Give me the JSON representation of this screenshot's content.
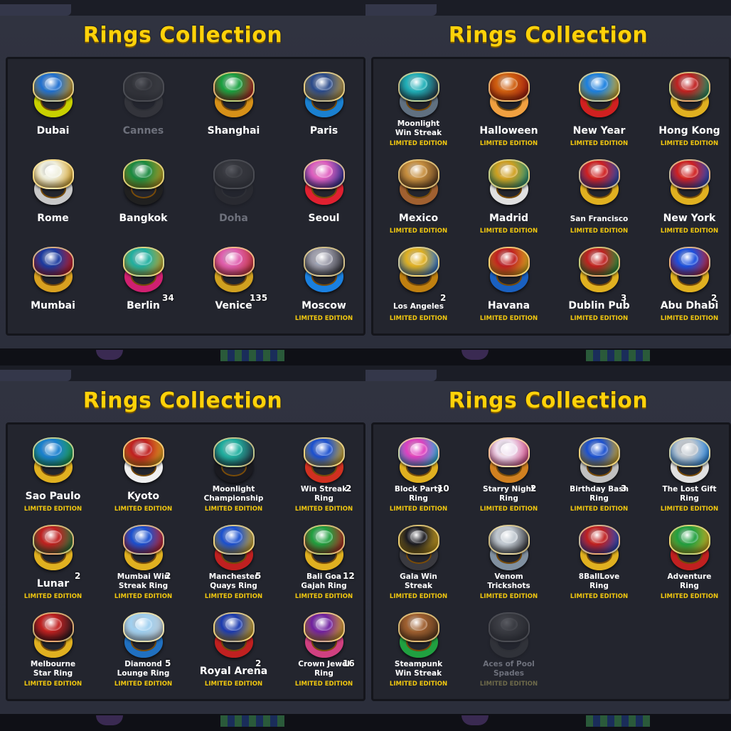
{
  "title": "Rings Collection",
  "limited_label": "LIMITED EDITION",
  "quadrants": [
    {
      "rings": [
        {
          "name": "Dubai",
          "collected": true,
          "colors": [
            "#1e6fd0",
            "#d89a1a",
            "#c8d000"
          ]
        },
        {
          "name": "Cannes",
          "collected": false,
          "colors": [
            "#c0402a",
            "#8a8a8a",
            "#b05050"
          ]
        },
        {
          "name": "Shanghai",
          "collected": true,
          "colors": [
            "#18a040",
            "#c01820",
            "#d69018"
          ]
        },
        {
          "name": "Paris",
          "collected": true,
          "colors": [
            "#2a4a8a",
            "#c8a040",
            "#1a80d0"
          ]
        },
        {
          "name": "Rome",
          "collected": true,
          "colors": [
            "#f0f0e0",
            "#d6a020",
            "#c8c8c8"
          ]
        },
        {
          "name": "Bangkok",
          "collected": true,
          "colors": [
            "#1a8a40",
            "#c89a20",
            "#202020"
          ]
        },
        {
          "name": "Doha",
          "collected": false,
          "colors": [
            "#7a6a4a",
            "#505a7a",
            "#3a3a4a"
          ]
        },
        {
          "name": "Seoul",
          "collected": true,
          "colors": [
            "#e060c0",
            "#1a2a8a",
            "#e02030"
          ]
        },
        {
          "name": "Mumbai",
          "collected": true,
          "colors": [
            "#1a3aa0",
            "#d01818",
            "#d8a020"
          ]
        },
        {
          "name": "Berlin",
          "collected": true,
          "count": "34",
          "colors": [
            "#20b0a0",
            "#d0a020",
            "#d02070"
          ]
        },
        {
          "name": "Venice",
          "collected": true,
          "count": "135",
          "colors": [
            "#e060b0",
            "#c03030",
            "#d0a020"
          ]
        },
        {
          "name": "Moscow",
          "collected": true,
          "limited": true,
          "colors": [
            "#9a9aa8",
            "#2a2a30",
            "#1a80e0"
          ]
        }
      ]
    },
    {
      "rings": [
        {
          "name": "Moonlight\nWin Streak",
          "small": true,
          "collected": true,
          "limited": true,
          "colors": [
            "#20b0b8",
            "#2a3040",
            "#607080"
          ]
        },
        {
          "name": "Halloween",
          "collected": true,
          "limited": true,
          "colors": [
            "#d06010",
            "#a01810",
            "#f0a040"
          ]
        },
        {
          "name": "New Year",
          "collected": true,
          "limited": true,
          "colors": [
            "#1a80e0",
            "#e0b020",
            "#d02020"
          ]
        },
        {
          "name": "Hong Kong",
          "collected": true,
          "limited": true,
          "colors": [
            "#c02020",
            "#18a070",
            "#e0b020"
          ]
        },
        {
          "name": "Mexico",
          "collected": true,
          "limited": true,
          "colors": [
            "#c89040",
            "#5a3a20",
            "#a06030"
          ]
        },
        {
          "name": "Madrid",
          "collected": true,
          "limited": true,
          "colors": [
            "#d0a020",
            "#1a9080",
            "#e0e0e0"
          ]
        },
        {
          "name": "San Francisco",
          "small": true,
          "collected": true,
          "limited": true,
          "colors": [
            "#d02020",
            "#1a50c0",
            "#e0b020"
          ]
        },
        {
          "name": "New York",
          "collected": true,
          "limited": true,
          "colors": [
            "#d02020",
            "#1a50d0",
            "#e0b020"
          ]
        },
        {
          "name": "Los Angeles",
          "small": true,
          "collected": true,
          "limited": true,
          "count": "2",
          "colors": [
            "#e0b020",
            "#2070e0",
            "#c08010"
          ]
        },
        {
          "name": "Havana",
          "collected": true,
          "limited": true,
          "colors": [
            "#c02020",
            "#e0c020",
            "#1a60c0"
          ]
        },
        {
          "name": "Dublin Pub",
          "collected": true,
          "limited": true,
          "count": "3",
          "colors": [
            "#c02020",
            "#20a040",
            "#e0b020"
          ]
        },
        {
          "name": "Abu Dhabi",
          "collected": true,
          "limited": true,
          "count": "2",
          "colors": [
            "#1a50e0",
            "#d02020",
            "#e0b020"
          ]
        }
      ]
    },
    {
      "rings": [
        {
          "name": "Sao Paulo",
          "collected": true,
          "limited": true,
          "colors": [
            "#1a80d0",
            "#20a040",
            "#e0b020"
          ]
        },
        {
          "name": "Kyoto",
          "collected": true,
          "limited": true,
          "colors": [
            "#c02020",
            "#e0b020",
            "#f0f0f0"
          ]
        },
        {
          "name": "Moonlight\nChampionship",
          "small": true,
          "collected": true,
          "limited": true,
          "colors": [
            "#20b0a0",
            "#2a3040",
            "#1a1a20"
          ]
        },
        {
          "name": "Win Streak\nRing",
          "small": true,
          "collected": true,
          "limited": true,
          "count": "2",
          "colors": [
            "#1a50d0",
            "#e0b020",
            "#d03020"
          ]
        },
        {
          "name": "Lunar",
          "collected": true,
          "limited": true,
          "count": "2",
          "colors": [
            "#c02020",
            "#208040",
            "#e0b020"
          ]
        },
        {
          "name": "Mumbai Win\nStreak Ring",
          "small": true,
          "collected": true,
          "limited": true,
          "count": "2",
          "colors": [
            "#1a50d0",
            "#d02020",
            "#e0b020"
          ]
        },
        {
          "name": "Manchester\nQuays Ring",
          "small": true,
          "collected": true,
          "limited": true,
          "count": "5",
          "colors": [
            "#1a50d0",
            "#e0b020",
            "#c02020"
          ]
        },
        {
          "name": "Bali Goa\nGajah Ring",
          "small": true,
          "collected": true,
          "limited": true,
          "count": "12",
          "colors": [
            "#20a040",
            "#c02020",
            "#e0b020"
          ]
        },
        {
          "name": "Melbourne\nStar Ring",
          "small": true,
          "collected": true,
          "limited": true,
          "colors": [
            "#c02020",
            "#1a1a20",
            "#e0b020"
          ]
        },
        {
          "name": "Diamond\nLounge Ring",
          "small": true,
          "collected": true,
          "limited": true,
          "count": "5",
          "colors": [
            "#a0d0f0",
            "#c0c8d0",
            "#2070c0"
          ]
        },
        {
          "name": "Royal Arena",
          "collected": true,
          "limited": true,
          "count": "2",
          "colors": [
            "#1a3ab0",
            "#e0b020",
            "#c02020"
          ]
        },
        {
          "name": "Crown Jewel\nRing",
          "small": true,
          "collected": true,
          "limited": true,
          "count": "16",
          "colors": [
            "#7020a0",
            "#e0b020",
            "#d04080"
          ]
        }
      ]
    },
    {
      "rings": [
        {
          "name": "Block Party\nRing",
          "small": true,
          "collected": true,
          "limited": true,
          "count": "10",
          "colors": [
            "#e040c0",
            "#20c0e0",
            "#e0b020"
          ]
        },
        {
          "name": "Starry Night\nRing",
          "small": true,
          "collected": true,
          "limited": true,
          "count": "2",
          "colors": [
            "#f0e0f0",
            "#d04080",
            "#d08020"
          ]
        },
        {
          "name": "Birthday Bash\nRing",
          "small": true,
          "collected": true,
          "limited": true,
          "count": "3",
          "colors": [
            "#1a50d0",
            "#e0b020",
            "#c0c0c0"
          ]
        },
        {
          "name": "The Lost Gift\nRing",
          "small": true,
          "collected": true,
          "limited": true,
          "colors": [
            "#c0c8d0",
            "#1a80e0",
            "#e0e0e0"
          ]
        },
        {
          "name": "Gala Win\nStreak",
          "small": true,
          "collected": true,
          "limited": true,
          "colors": [
            "#1a1a20",
            "#e0b020",
            "#3a3a40"
          ]
        },
        {
          "name": "Venom\nTrickshots",
          "small": true,
          "collected": true,
          "limited": true,
          "colors": [
            "#c0c8d0",
            "#2a2a30",
            "#8090a0"
          ]
        },
        {
          "name": "8BallLove\nRing",
          "small": true,
          "collected": true,
          "limited": true,
          "colors": [
            "#c02020",
            "#1a50d0",
            "#e0b020"
          ]
        },
        {
          "name": "Adventure\nRing",
          "small": true,
          "collected": true,
          "limited": true,
          "colors": [
            "#20a040",
            "#e0b020",
            "#c02020"
          ]
        },
        {
          "name": "Steampunk\nWin Streak",
          "small": true,
          "collected": true,
          "limited": true,
          "colors": [
            "#a06030",
            "#5a3a20",
            "#20a040"
          ]
        },
        {
          "name": "Aces of Pool\nSpades",
          "small": true,
          "collected": false,
          "limited": true,
          "colors": [
            "#7a7a80",
            "#3a3a40",
            "#5a5a60"
          ]
        }
      ]
    }
  ]
}
